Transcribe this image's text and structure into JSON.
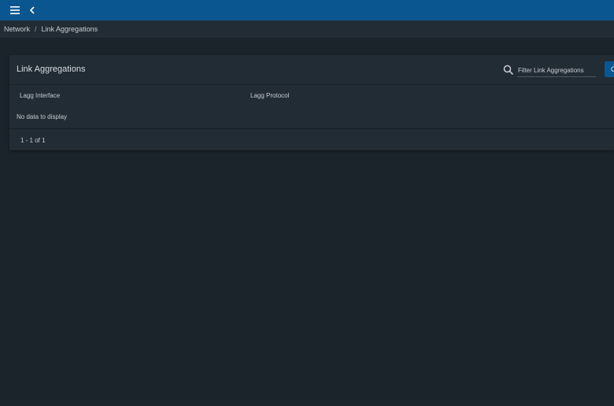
{
  "topbar": {
    "menu_icon": "hamburger-menu-icon",
    "back_icon": "chevron-left-icon",
    "color": "#0a5690"
  },
  "breadcrumb": {
    "parent": "Network",
    "separator": "/",
    "current": "Link Aggregations"
  },
  "card": {
    "title": "Link Aggregations",
    "search_icon": "search-icon",
    "filter_placeholder": "Filter Link Aggregations",
    "add_button_label": "C"
  },
  "table": {
    "columns": [
      "Lagg Interface",
      "Lagg Protocol"
    ],
    "empty_message": "No data to display",
    "pagination": "1 - 1 of 1"
  }
}
